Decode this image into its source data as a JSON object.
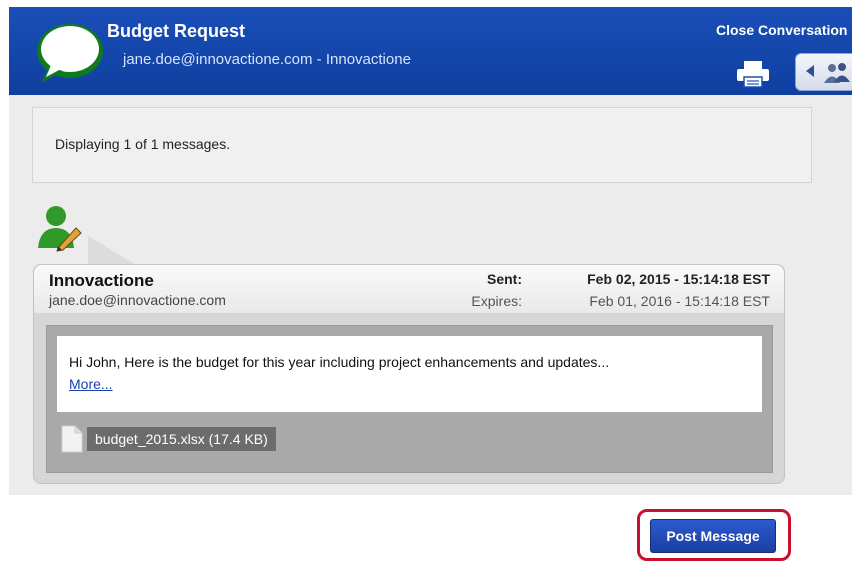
{
  "header": {
    "title": "Budget Request",
    "subtitle": "jane.doe@innovactione.com - Innovactione",
    "close_label": "Close Conversation",
    "logo_icon": "speech-bubble-icon",
    "print_icon": "printer-icon",
    "people_icon": "people-icon"
  },
  "info": {
    "display_text": "Displaying 1 of 1 messages."
  },
  "message": {
    "avatar_icon": "user-edit-icon",
    "sender_name": "Innovactione",
    "sender_email": "jane.doe@innovactione.com",
    "sent_label": "Sent:",
    "sent_value": "Feb 02, 2015 - 15:14:18 EST",
    "expires_label": "Expires:",
    "expires_value": "Feb 01, 2016 - 15:14:18 EST",
    "body": "Hi John,  Here is the budget for this year including project enhancements and updates...",
    "more_label": "More...",
    "attachment": {
      "label": "budget_2015.xlsx (17.4 KB)",
      "icon": "file-icon"
    }
  },
  "actions": {
    "post_label": "Post Message"
  },
  "colors": {
    "header_blue": "#1a4fb8",
    "button_blue": "#2c5ad1",
    "highlight_red": "#c8102e"
  }
}
